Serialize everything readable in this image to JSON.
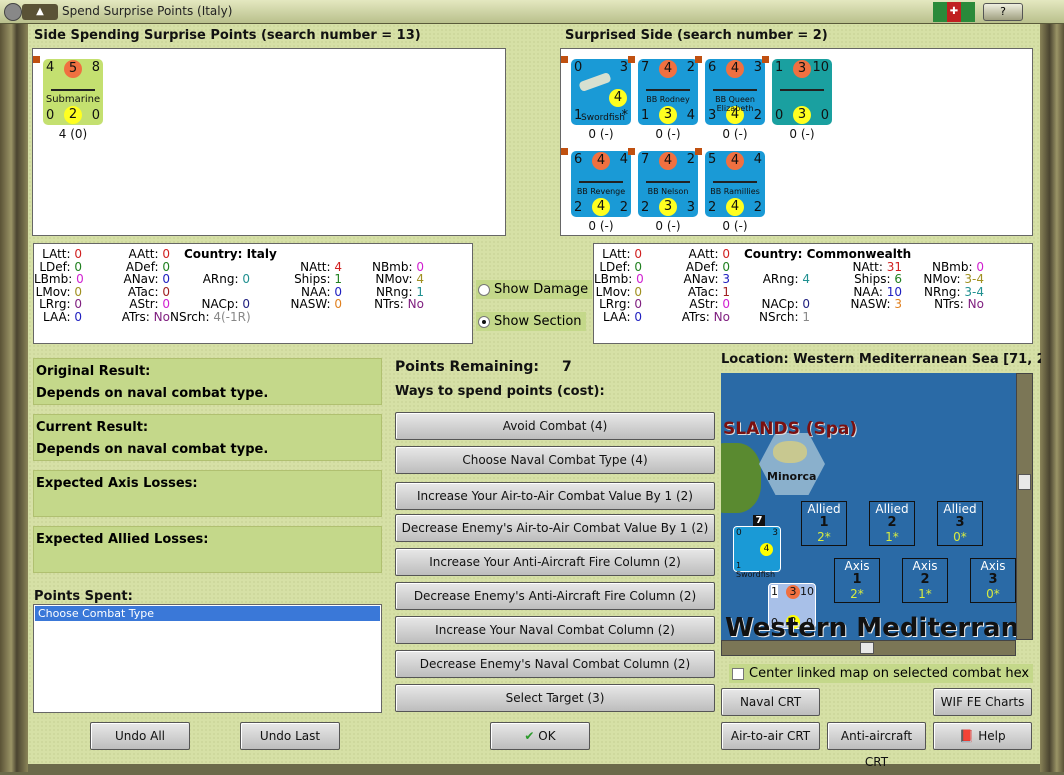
{
  "window": {
    "title": "Spend Surprise Points (Italy)",
    "help_btn": "?"
  },
  "left_side": {
    "header": "Side Spending Surprise Points (search number = 13)",
    "counters": [
      {
        "tl": "4",
        "tm": "5",
        "tr": "8",
        "name": "Submarine",
        "bl": "0",
        "bm": "2",
        "br": "0",
        "below": "4 (0)",
        "bg": "#c4e070"
      }
    ]
  },
  "right_side": {
    "header": "Surprised Side (search number = 2)",
    "counters": [
      {
        "tl": "0",
        "tm": "",
        "tr": "3",
        "name": "Swordfish",
        "bl": "1",
        "bm": "",
        "br": "*",
        "badge": "4",
        "below": "0 (-)",
        "bg": "#1a9ad6",
        "type": "air"
      },
      {
        "tl": "7",
        "tm": "4",
        "tr": "2",
        "name": "BB Rodney",
        "bl": "1",
        "bm": "3",
        "br": "4",
        "below": "0 (-)",
        "bg": "#1a9ad6"
      },
      {
        "tl": "6",
        "tm": "4",
        "tr": "3",
        "name": "BB Queen Elizabeth",
        "bl": "3",
        "bm": "4",
        "br": "2",
        "below": "0 (-)",
        "bg": "#1a9ad6"
      },
      {
        "tl": "1",
        "tm": "3",
        "tr": "10",
        "name": "",
        "bl": "0",
        "bm": "3",
        "br": "0",
        "below": "0 (-)",
        "bg": "#1aa0a0"
      },
      {
        "tl": "6",
        "tm": "4",
        "tr": "4",
        "name": "BB Revenge",
        "bl": "2",
        "bm": "4",
        "br": "2",
        "below": "0 (-)",
        "bg": "#1a9ad6"
      },
      {
        "tl": "7",
        "tm": "4",
        "tr": "2",
        "name": "BB Nelson",
        "bl": "2",
        "bm": "3",
        "br": "3",
        "below": "0 (-)",
        "bg": "#1a9ad6"
      },
      {
        "tl": "5",
        "tm": "4",
        "tr": "4",
        "name": "BB Ramillies",
        "bl": "2",
        "bm": "4",
        "br": "2",
        "below": "0 (-)",
        "bg": "#1a9ad6"
      }
    ]
  },
  "stats_left": {
    "country": "Country: Italy",
    "columns": [
      [
        [
          "LAtt:",
          "0",
          "#d02020"
        ],
        [
          "LDef:",
          "0",
          "#208020"
        ],
        [
          "LBmb:",
          "0",
          "#d020d0"
        ],
        [
          "LMov:",
          "0",
          "#a09020"
        ],
        [
          "LRrg:",
          "0",
          "#802080"
        ],
        [
          "LAA:",
          "0",
          "#2020c0"
        ]
      ],
      [
        [
          "AAtt:",
          "0",
          "#d02020"
        ],
        [
          "ADef:",
          "0",
          "#208020"
        ],
        [
          "ANav:",
          "0",
          "#2020c0"
        ],
        [
          "ATac:",
          "0",
          "#a02020"
        ],
        [
          "AStr:",
          "0",
          "#d020d0"
        ],
        [
          "ATrs:",
          "No",
          "#802080"
        ]
      ],
      [
        [
          "ARng:",
          "0",
          "#209090"
        ],
        [
          "NACp:",
          "0",
          "#202080"
        ],
        [
          "NSrch:",
          "4(-1R)",
          "#888888"
        ]
      ],
      [
        [
          "NAtt:",
          "4",
          "#d02020"
        ],
        [
          "Ships:",
          "1",
          "#208020"
        ],
        [
          "NAA:",
          "0",
          "#2020c0"
        ],
        [
          "NASW:",
          "0",
          "#e08020"
        ]
      ],
      [
        [
          "NBmb:",
          "0",
          "#d020d0"
        ],
        [
          "NMov:",
          "4",
          "#a09020"
        ],
        [
          "NRng:",
          "1",
          "#209090"
        ],
        [
          "NTrs:",
          "No",
          "#802080"
        ]
      ]
    ]
  },
  "stats_right": {
    "country": "Country: Commonwealth",
    "columns": [
      [
        [
          "LAtt:",
          "0",
          "#d02020"
        ],
        [
          "LDef:",
          "0",
          "#208020"
        ],
        [
          "LBmb:",
          "0",
          "#d020d0"
        ],
        [
          "LMov:",
          "0",
          "#a09020"
        ],
        [
          "LRrg:",
          "0",
          "#802080"
        ],
        [
          "LAA:",
          "0",
          "#2020c0"
        ]
      ],
      [
        [
          "AAtt:",
          "0",
          "#d02020"
        ],
        [
          "ADef:",
          "0",
          "#208020"
        ],
        [
          "ANav:",
          "3",
          "#2020c0"
        ],
        [
          "ATac:",
          "1",
          "#a02020"
        ],
        [
          "AStr:",
          "0",
          "#d020d0"
        ],
        [
          "ATrs:",
          "No",
          "#802080"
        ]
      ],
      [
        [
          "ARng:",
          "4",
          "#209090"
        ],
        [
          "NACp:",
          "0",
          "#202080"
        ],
        [
          "NSrch:",
          "1",
          "#888888"
        ]
      ],
      [
        [
          "NAtt:",
          "31",
          "#d02020"
        ],
        [
          "Ships:",
          "6",
          "#208020"
        ],
        [
          "NAA:",
          "10",
          "#2020c0"
        ],
        [
          "NASW:",
          "3",
          "#e08020"
        ]
      ],
      [
        [
          "NBmb:",
          "0",
          "#d020d0"
        ],
        [
          "NMov:",
          "3-4",
          "#a09020"
        ],
        [
          "NRng:",
          "3-4",
          "#209090"
        ],
        [
          "NTrs:",
          "No",
          "#802080"
        ]
      ]
    ]
  },
  "options": {
    "show_damage": "Show Damage",
    "show_section": "Show Section",
    "selected": "show_section"
  },
  "results": [
    {
      "label": "Original Result:",
      "value": "Depends on naval combat type."
    },
    {
      "label": "Current Result:",
      "value": "Depends on naval combat type."
    },
    {
      "label": "Expected Axis Losses:",
      "value": ""
    },
    {
      "label": "Expected Allied Losses:",
      "value": ""
    }
  ],
  "points_spent": {
    "label": "Points Spent:",
    "items": [
      "Choose Combat Type"
    ]
  },
  "points": {
    "remaining_label": "Points Remaining:",
    "remaining": "7",
    "ways_label": "Ways to spend points (cost):"
  },
  "ways": [
    "Avoid Combat (4)",
    "Choose Naval Combat Type (4)",
    "Increase Your Air-to-Air Combat Value By 1 (2)",
    "Decrease Enemy's Air-to-Air Combat Value By 1 (2)",
    "Increase Your Anti-Aircraft Fire Column (2)",
    "Decrease Enemy's Anti-Aircraft Fire Column (2)",
    "Increase Your Naval Combat Column (2)",
    "Decrease Enemy's Naval Combat Column (2)",
    "Select Target (3)"
  ],
  "map": {
    "location": "Location: Western Mediterranean Sea [71, 2",
    "region": "SLANDS (Spa)",
    "island": "Minorca",
    "sea": "Western Mediterranean",
    "stack_count": "7",
    "allied": [
      {
        "side": "Allied",
        "n": "1",
        "v": "2*"
      },
      {
        "side": "Allied",
        "n": "2",
        "v": "1*"
      },
      {
        "side": "Allied",
        "n": "3",
        "v": "0*"
      }
    ],
    "axis": [
      {
        "side": "Axis",
        "n": "1",
        "v": "2*"
      },
      {
        "side": "Axis",
        "n": "2",
        "v": "1*"
      },
      {
        "side": "Axis",
        "n": "3",
        "v": "0*"
      }
    ],
    "center_checkbox": "Center linked map on selected combat hex",
    "center_checked": false
  },
  "buttons": {
    "undo_all": "Undo All",
    "undo_last": "Undo Last",
    "ok": "OK",
    "naval_crt": "Naval CRT",
    "wif_charts": "WIF FE Charts",
    "air_crt": "Air-to-air CRT",
    "aa_crt": "Anti-aircraft CRT",
    "help": "Help"
  }
}
